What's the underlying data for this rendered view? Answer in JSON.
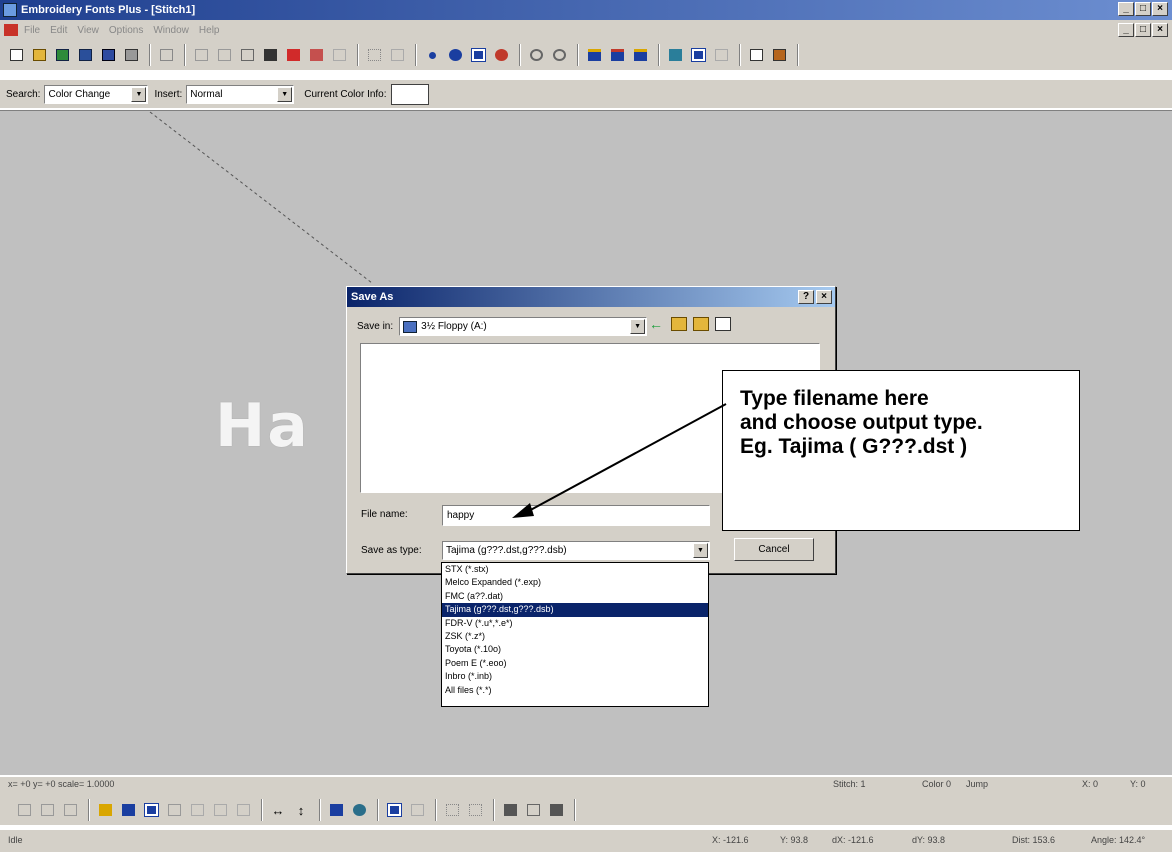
{
  "window": {
    "title": "Embroidery Fonts Plus - [Stitch1]",
    "controls": [
      "_",
      "□",
      "×"
    ]
  },
  "menubar": {
    "items": [
      "File",
      "Edit",
      "View",
      "Options",
      "Window",
      "Help"
    ]
  },
  "searchbar": {
    "search_label": "Search:",
    "search_value": "Color Change",
    "insert_label": "Insert:",
    "insert_value": "Normal",
    "color_info_label": "Current Color Info:"
  },
  "canvas": {
    "text": "Ha"
  },
  "statusbar": {
    "coords": "x= +0 y= +0 scale= 1.0000",
    "stitch": "Stitch: 1",
    "color": "Color 0",
    "jump": "Jump",
    "x": "X: 0",
    "y": "Y: 0",
    "idle": "Idle",
    "x2": "X: -121.6",
    "y2": "Y: 93.8",
    "dx": "dX: -121.6",
    "dy": "dY: 93.8",
    "dist": "Dist: 153.6",
    "angle": "Angle: 142.4°"
  },
  "dialog": {
    "title": "Save As",
    "help_btn": "?",
    "close_btn": "×",
    "save_in_label": "Save in:",
    "save_in_value": "3½ Floppy (A:)",
    "file_name_label": "File name:",
    "file_name_value": "happy",
    "save_type_label": "Save as type:",
    "save_type_value": "Tajima (g???.dst,g???.dsb)",
    "cancel_label": "Cancel"
  },
  "dropdown": {
    "options": [
      "STX (*.stx)",
      "Melco Expanded (*.exp)",
      "FMC (a??.dat)",
      "Tajima (g???.dst,g???.dsb)",
      "FDR-V (*.u*,*.e*)",
      "ZSK (*.z*)",
      "Toyota (*.10o)",
      "Poem E (*.eoo)",
      "Inbro (*.inb)",
      "All files (*.*)"
    ],
    "selected_index": 3
  },
  "callout": {
    "line1": "Type filename here",
    "line2": "and choose output type.",
    "line3": "Eg. Tajima ( G???.dst )"
  },
  "colors": {
    "titlebar": "#1f3f8f",
    "selection": "#0a246a",
    "canvas": "#c0c0c0",
    "chrome": "#d4d0c8"
  }
}
